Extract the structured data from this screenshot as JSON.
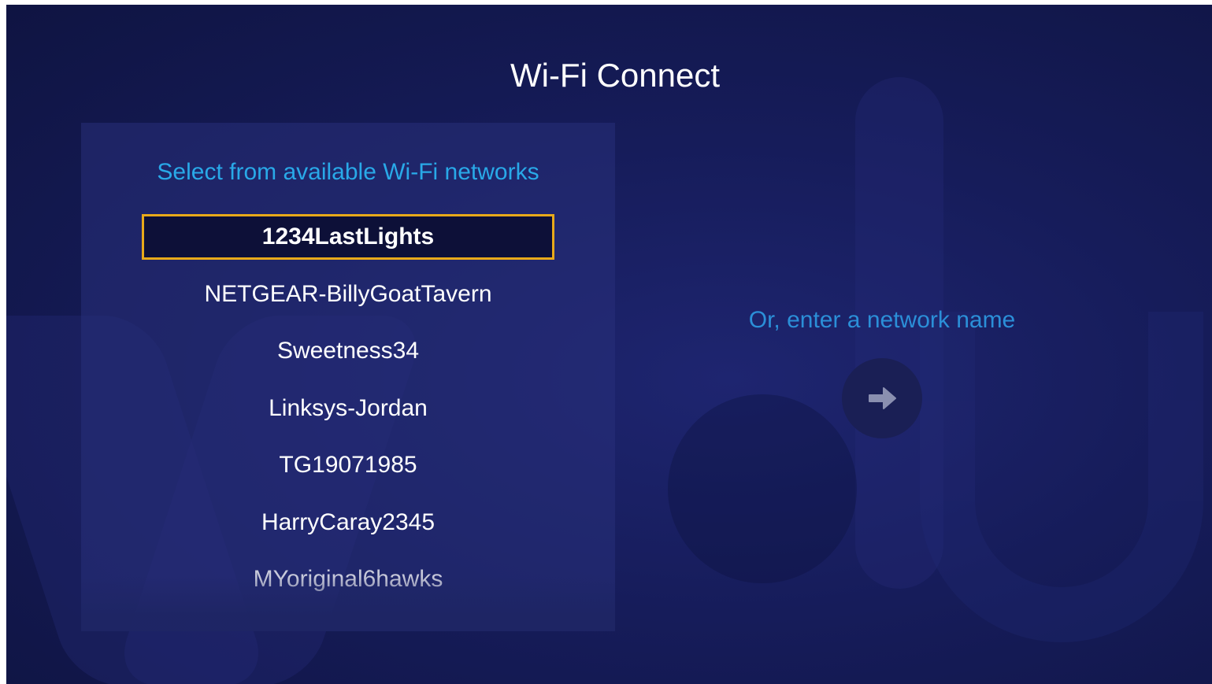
{
  "screen": {
    "title": "Wi-Fi Connect"
  },
  "network_panel": {
    "heading": "Select from available Wi-Fi networks",
    "networks": [
      {
        "name": "1234LastLights",
        "selected": true
      },
      {
        "name": "NETGEAR-BillyGoatTavern",
        "selected": false
      },
      {
        "name": "Sweetness34",
        "selected": false
      },
      {
        "name": "Linksys-Jordan",
        "selected": false
      },
      {
        "name": "TG19071985",
        "selected": false
      },
      {
        "name": "HarryCaray2345",
        "selected": false
      },
      {
        "name": "MYoriginal6hawks",
        "selected": false
      }
    ]
  },
  "manual_entry": {
    "label": "Or, enter a network name",
    "button_icon": "arrow-right-icon"
  },
  "colors": {
    "background": "#161c5a",
    "accent_heading": "#29a9e8",
    "selection_border": "#e8a91a",
    "text": "#ffffff"
  }
}
